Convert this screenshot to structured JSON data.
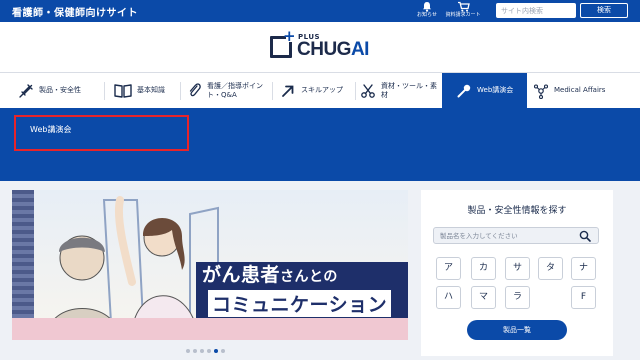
{
  "topbar": {
    "site_label": "看護師・保健師向けサイト",
    "tools": [
      {
        "icon": "bell-icon",
        "label": "お知らせ"
      },
      {
        "icon": "cart-icon",
        "label": "資料請求カート"
      }
    ],
    "search_placeholder": "サイト内検索",
    "search_button": "検索"
  },
  "logo": {
    "plus": "PLUS",
    "brand_main": "CHUG",
    "brand_accent": "AI"
  },
  "nav": {
    "items": [
      {
        "icon": "syringe-icon",
        "label": "製品・安全性"
      },
      {
        "icon": "book-icon",
        "label": "基本知識"
      },
      {
        "icon": "paperclip-icon",
        "label": "看護／指導ポイント・Q&A"
      },
      {
        "icon": "arrow-up-icon",
        "label": "スキルアップ"
      },
      {
        "icon": "scissors-icon",
        "label": "資材・ツール・素材"
      },
      {
        "icon": "microphone-icon",
        "label": "Web講演会"
      },
      {
        "icon": "molecule-icon",
        "label": "Medical Affairs"
      }
    ],
    "active_index": 5
  },
  "dropdown": {
    "items": [
      "Web講演会"
    ]
  },
  "banner": {
    "title_line1_main": "がん患者",
    "title_line1_small": "さんとの",
    "title_line2": "コミュニケーション",
    "slide_count": 6,
    "active_slide": 5
  },
  "panel": {
    "title": "製品・安全性情報を探す",
    "search_placeholder": "製品名を入力してください",
    "kana_row1": [
      "ア",
      "カ",
      "サ",
      "タ",
      "ナ"
    ],
    "kana_row2": [
      "ハ",
      "マ",
      "ラ",
      "",
      "F"
    ],
    "list_button": "製品一覧"
  },
  "colors": {
    "brand_blue": "#0b4aa8",
    "highlight_red": "#e8242a",
    "navy": "#1e2f6a"
  }
}
